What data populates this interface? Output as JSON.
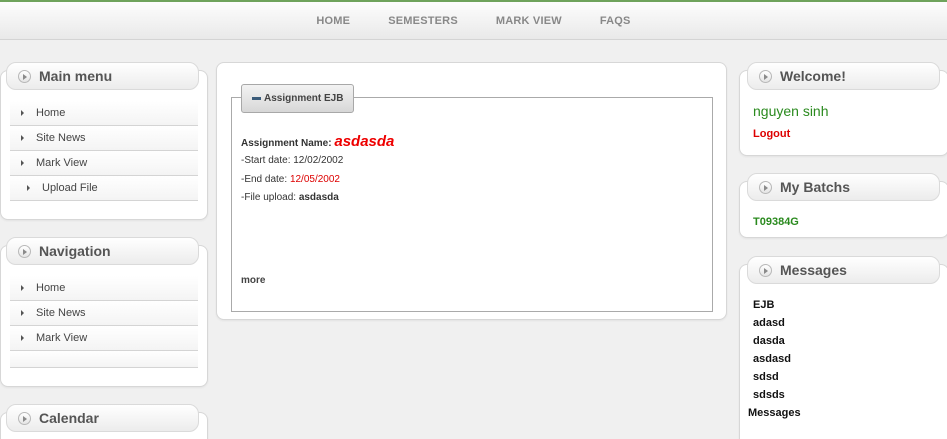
{
  "topnav": {
    "items": [
      "HOME",
      "SEMESTERS",
      "MARK VIEW",
      "FAQS"
    ]
  },
  "main_menu": {
    "title": "Main menu",
    "items": [
      "Home",
      "Site News",
      "Mark View",
      "Upload File"
    ]
  },
  "navigation": {
    "title": "Navigation",
    "items": [
      "Home",
      "Site News",
      "Mark View"
    ]
  },
  "calendar": {
    "title": "Calendar"
  },
  "assignment": {
    "legend": "Assignment EJB",
    "name_label": "Assignment Name:",
    "name_value": "asdasda",
    "start_label": "-Start date:",
    "start_value": "12/02/2002",
    "end_label": "-End date:",
    "end_value": "12/05/2002",
    "file_label": "-File upload:",
    "file_value": "asdasda",
    "more": "more"
  },
  "welcome": {
    "title": "Welcome!",
    "user": "nguyen sinh",
    "logout": "Logout"
  },
  "batchs": {
    "title": "My Batchs",
    "items": [
      "T09384G"
    ]
  },
  "messages": {
    "title": "Messages",
    "items": [
      "EJB",
      "adasd",
      "dasda",
      "asdasd",
      "sdsd",
      "sdsds"
    ],
    "footer": "Messages"
  },
  "colors": {
    "accent_green": "#2a8a1e",
    "alert_red": "#dd0000",
    "top_border": "#6fa35c"
  }
}
